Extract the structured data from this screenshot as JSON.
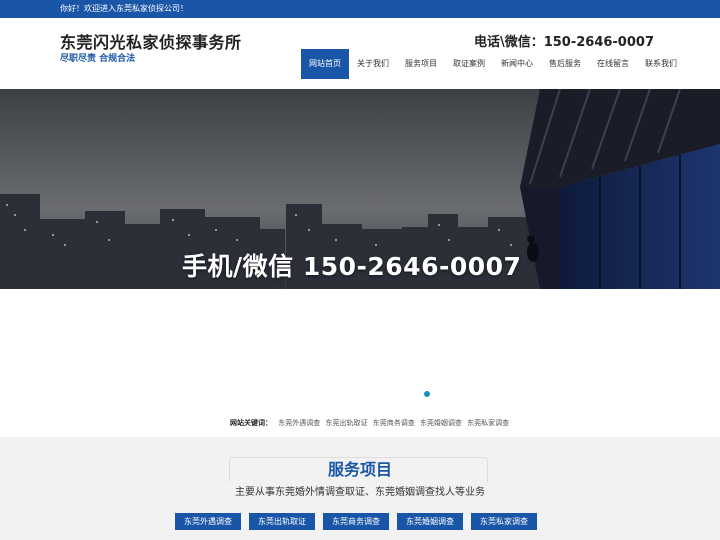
{
  "topbar": {
    "welcome": "你好！欢迎进入东莞私家侦探公司！"
  },
  "header": {
    "title": "东莞闪光私家侦探事务所",
    "slogan": "尽职尽责 合规合法",
    "phone": "电话\\微信：150-2646-0007"
  },
  "nav": {
    "items": [
      {
        "label": "网站首页",
        "active": true
      },
      {
        "label": "关于我们"
      },
      {
        "label": "服务项目"
      },
      {
        "label": "取证案例"
      },
      {
        "label": "新闻中心"
      },
      {
        "label": "售后服务"
      },
      {
        "label": "在线留言"
      },
      {
        "label": "联系我们"
      }
    ]
  },
  "hero": {
    "text": "手机/微信 150-2646-0007"
  },
  "keywords": {
    "label": "网站关键词：",
    "items": [
      "东莞外遇调查",
      "东莞出轨取证",
      "东莞商务调查",
      "东莞婚姻调查",
      "东莞私家调查"
    ]
  },
  "services": {
    "title": "服务项目",
    "subtitle": "主要从事东莞婚外情调查取证、东莞婚姻调查找人等业务",
    "buttons": [
      "东莞外遇调查",
      "东莞出轨取证",
      "东莞商务调查",
      "东莞婚姻调查",
      "东莞私家调查"
    ]
  },
  "colors": {
    "brand": "#1a56a8",
    "accent_dot": "#1a8fb5"
  }
}
